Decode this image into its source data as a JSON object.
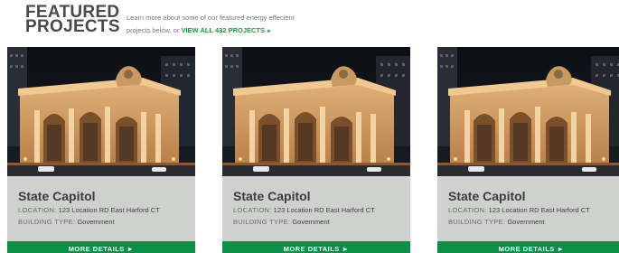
{
  "header": {
    "title_line1": "FEATURED",
    "title_line2": "PROJECTS",
    "intro_line1": "Learn more about some of our featured energy effecient",
    "intro_line2": "projects below, or",
    "view_all_label": "VIEW ALL 432 PROJECTS",
    "view_all_arrow": "►"
  },
  "cards": [
    {
      "name": "State Capitol",
      "location_key": "LOCATION:",
      "location_value": "123 Location RD East Harford CT",
      "type_key": "BUILDING TYPE:",
      "type_value": "Government",
      "button_label": "MORE DETAILS ►",
      "photo_icon": "building-photo"
    },
    {
      "name": "State Capitol",
      "location_key": "LOCATION:",
      "location_value": "123 Location RD East Harford CT",
      "type_key": "BUILDING TYPE:",
      "type_value": "Government",
      "button_label": "MORE DETAILS ►",
      "photo_icon": "building-photo"
    },
    {
      "name": "State Capitol",
      "location_key": "LOCATION:",
      "location_value": "123 Location RD East Harford CT",
      "type_key": "BUILDING TYPE:",
      "type_value": "Government",
      "button_label": "MORE DETAILS ►",
      "photo_icon": "building-photo"
    }
  ],
  "colors": {
    "accent_green": "#0c8f46",
    "link_green": "#1a9a4a",
    "card_bg": "#cfd1cf"
  }
}
